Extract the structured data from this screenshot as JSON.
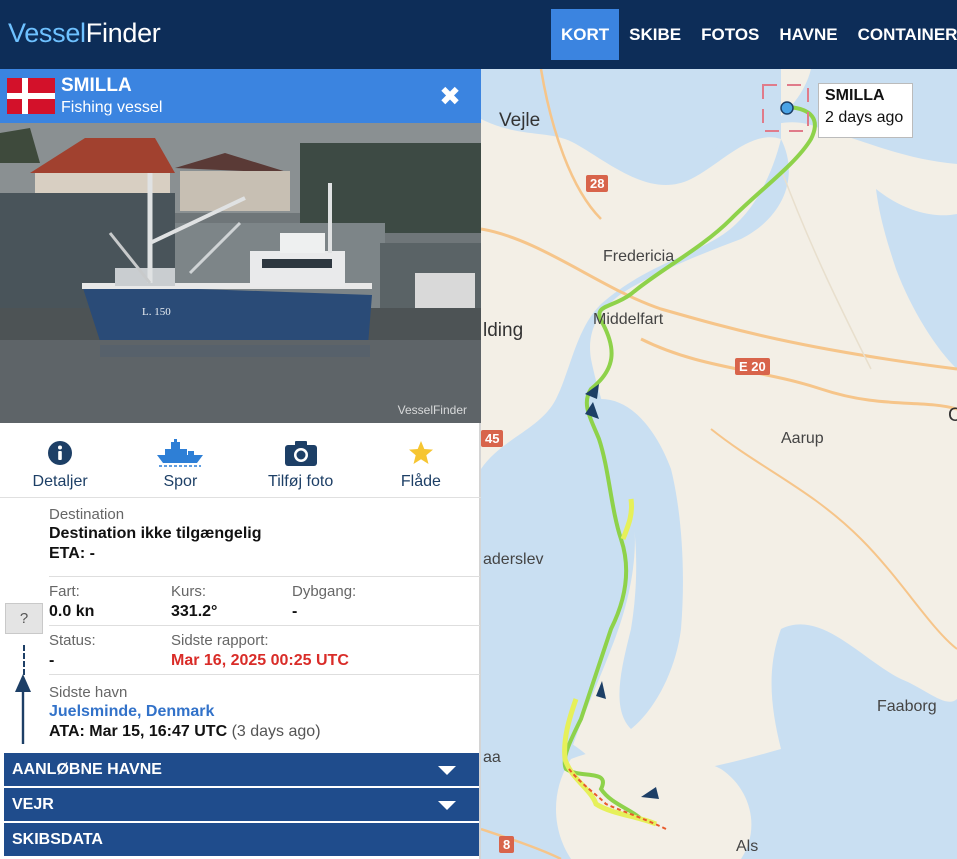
{
  "header": {
    "logo_part1": "Vessel",
    "logo_part2": "Finder",
    "nav": [
      {
        "label": "KORT",
        "active": true
      },
      {
        "label": "SKIBE"
      },
      {
        "label": "FOTOS"
      },
      {
        "label": "HAVNE"
      },
      {
        "label": "CONTAINERE"
      }
    ]
  },
  "vessel": {
    "name": "SMILLA",
    "type": "Fishing vessel",
    "flag": "Denmark",
    "photo_watermark": "VesselFinder",
    "hull_marking": "L. 150"
  },
  "actions": [
    {
      "label": "Detaljer",
      "icon": "info-icon"
    },
    {
      "label": "Spor",
      "icon": "ship-track-icon"
    },
    {
      "label": "Tilføj foto",
      "icon": "camera-icon"
    },
    {
      "label": "Flåde",
      "icon": "star-icon"
    }
  ],
  "voyage": {
    "destination_label": "Destination",
    "destination_value": "Destination ikke tilgængelig",
    "eta": "ETA: -",
    "unknown_icon": "?",
    "speed_label": "Fart:",
    "speed_value": "0.0 kn",
    "course_label": "Kurs:",
    "course_value": "331.2°",
    "draught_label": "Dybgang:",
    "draught_value": "-",
    "status_label": "Status:",
    "status_value": "-",
    "report_label": "Sidste rapport:",
    "report_value": "Mar 16, 2025 00:25 UTC",
    "last_port_label": "Sidste havn",
    "last_port_value": "Juelsminde, Denmark",
    "ata": "ATA: Mar 15, 16:47 UTC",
    "ata_rel": "(3 days ago)"
  },
  "sections": [
    "AANLØBNE HAVNE",
    "VEJR",
    "SKIBSDATA"
  ],
  "map": {
    "vessel_label_name": "SMILLA",
    "vessel_label_time": "2 days ago",
    "places": [
      "Vejle",
      "Fredericia",
      "Middelfart",
      "lding",
      "Aarup",
      "aderslev",
      "Faaborg",
      "Als",
      "aa",
      "C"
    ],
    "roads": [
      "28",
      "E 20",
      "45",
      "8"
    ],
    "colors": {
      "water": "#c9dff2",
      "land": "#f3efe6",
      "track": "#8ed24a",
      "highlight": "#e6f05a",
      "accent": "#3b84e0"
    }
  }
}
